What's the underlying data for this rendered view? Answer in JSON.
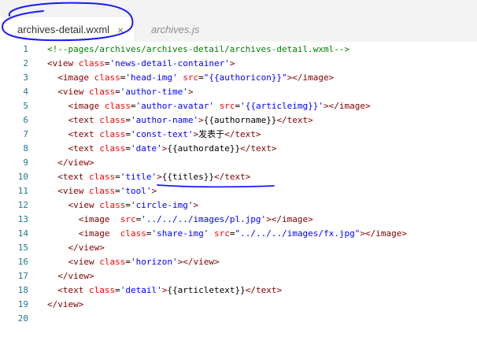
{
  "tabs": [
    {
      "label": "archives-detail.wxml",
      "active": true,
      "close": "×"
    },
    {
      "label": "archives.js",
      "active": false
    }
  ],
  "colors": {
    "comment": "#008000",
    "tag": "#800000",
    "attr": "#ff0000",
    "string": "#0000ff",
    "text": "#000000",
    "line_number": "#237893",
    "annotation": "#1a1aff"
  },
  "lines": [
    {
      "n": "1",
      "tokens": [
        {
          "t": "<!--pages/archives/archives-detail/archives-detail.wxml-->",
          "k": "comment"
        }
      ]
    },
    {
      "n": "2",
      "tokens": [
        {
          "t": "<view ",
          "k": "tag"
        },
        {
          "t": "class",
          "k": "attr"
        },
        {
          "t": "=",
          "k": "text"
        },
        {
          "t": "'news-detail-container'",
          "k": "string"
        },
        {
          "t": ">",
          "k": "tag"
        }
      ]
    },
    {
      "n": "3",
      "tokens": [
        {
          "t": "  ",
          "k": "text"
        },
        {
          "t": "<image ",
          "k": "tag"
        },
        {
          "t": "class",
          "k": "attr"
        },
        {
          "t": "=",
          "k": "text"
        },
        {
          "t": "'head-img'",
          "k": "string"
        },
        {
          "t": " ",
          "k": "text"
        },
        {
          "t": "src",
          "k": "attr"
        },
        {
          "t": "=",
          "k": "text"
        },
        {
          "t": "\"{{authoricon}}\"",
          "k": "string"
        },
        {
          "t": "></image>",
          "k": "tag"
        }
      ]
    },
    {
      "n": "4",
      "tokens": [
        {
          "t": "  ",
          "k": "text"
        },
        {
          "t": "<view ",
          "k": "tag"
        },
        {
          "t": "class",
          "k": "attr"
        },
        {
          "t": "=",
          "k": "text"
        },
        {
          "t": "'author-time'",
          "k": "string"
        },
        {
          "t": ">",
          "k": "tag"
        }
      ]
    },
    {
      "n": "5",
      "tokens": [
        {
          "t": "    ",
          "k": "text"
        },
        {
          "t": "<image ",
          "k": "tag"
        },
        {
          "t": "class",
          "k": "attr"
        },
        {
          "t": "=",
          "k": "text"
        },
        {
          "t": "'author-avatar'",
          "k": "string"
        },
        {
          "t": " ",
          "k": "text"
        },
        {
          "t": "src",
          "k": "attr"
        },
        {
          "t": "=",
          "k": "text"
        },
        {
          "t": "'{{articleimg}}'",
          "k": "string"
        },
        {
          "t": "></image>",
          "k": "tag"
        }
      ]
    },
    {
      "n": "6",
      "tokens": [
        {
          "t": "    ",
          "k": "text"
        },
        {
          "t": "<text ",
          "k": "tag"
        },
        {
          "t": "class",
          "k": "attr"
        },
        {
          "t": "=",
          "k": "text"
        },
        {
          "t": "'author-name'",
          "k": "string"
        },
        {
          "t": ">",
          "k": "tag"
        },
        {
          "t": "{{authorname}}",
          "k": "text"
        },
        {
          "t": "</text>",
          "k": "tag"
        }
      ]
    },
    {
      "n": "7",
      "tokens": [
        {
          "t": "    ",
          "k": "text"
        },
        {
          "t": "<text ",
          "k": "tag"
        },
        {
          "t": "class",
          "k": "attr"
        },
        {
          "t": "=",
          "k": "text"
        },
        {
          "t": "'const-text'",
          "k": "string"
        },
        {
          "t": ">",
          "k": "tag"
        },
        {
          "t": "发表于",
          "k": "text"
        },
        {
          "t": "</text>",
          "k": "tag"
        }
      ]
    },
    {
      "n": "8",
      "tokens": [
        {
          "t": "    ",
          "k": "text"
        },
        {
          "t": "<text ",
          "k": "tag"
        },
        {
          "t": "class",
          "k": "attr"
        },
        {
          "t": "=",
          "k": "text"
        },
        {
          "t": "'date'",
          "k": "string"
        },
        {
          "t": ">",
          "k": "tag"
        },
        {
          "t": "{{authordate}}",
          "k": "text"
        },
        {
          "t": "</text>",
          "k": "tag"
        }
      ]
    },
    {
      "n": "9",
      "tokens": [
        {
          "t": "  ",
          "k": "text"
        },
        {
          "t": "</view>",
          "k": "tag"
        }
      ]
    },
    {
      "n": "10",
      "tokens": [
        {
          "t": "  ",
          "k": "text"
        },
        {
          "t": "<text ",
          "k": "tag"
        },
        {
          "t": "class",
          "k": "attr"
        },
        {
          "t": "=",
          "k": "text"
        },
        {
          "t": "'title'",
          "k": "string"
        },
        {
          "t": ">",
          "k": "tag"
        },
        {
          "t": "{{titles}}",
          "k": "text"
        },
        {
          "t": "</text>",
          "k": "tag"
        }
      ]
    },
    {
      "n": "11",
      "tokens": [
        {
          "t": "  ",
          "k": "text"
        },
        {
          "t": "<view ",
          "k": "tag"
        },
        {
          "t": "class",
          "k": "attr"
        },
        {
          "t": "=",
          "k": "text"
        },
        {
          "t": "'tool'",
          "k": "string"
        },
        {
          "t": ">",
          "k": "tag"
        }
      ]
    },
    {
      "n": "12",
      "tokens": [
        {
          "t": "    ",
          "k": "text"
        },
        {
          "t": "<view ",
          "k": "tag"
        },
        {
          "t": "class",
          "k": "attr"
        },
        {
          "t": "=",
          "k": "text"
        },
        {
          "t": "'circle-img'",
          "k": "string"
        },
        {
          "t": ">",
          "k": "tag"
        }
      ]
    },
    {
      "n": "13",
      "tokens": [
        {
          "t": "      ",
          "k": "text"
        },
        {
          "t": "<image  ",
          "k": "tag"
        },
        {
          "t": "src",
          "k": "attr"
        },
        {
          "t": "=",
          "k": "text"
        },
        {
          "t": "'../../../images/pl.jpg'",
          "k": "string"
        },
        {
          "t": "></image>",
          "k": "tag"
        }
      ]
    },
    {
      "n": "14",
      "tokens": [
        {
          "t": "      ",
          "k": "text"
        },
        {
          "t": "<image  ",
          "k": "tag"
        },
        {
          "t": "class",
          "k": "attr"
        },
        {
          "t": "=",
          "k": "text"
        },
        {
          "t": "'share-img'",
          "k": "string"
        },
        {
          "t": " ",
          "k": "text"
        },
        {
          "t": "src",
          "k": "attr"
        },
        {
          "t": "=",
          "k": "text"
        },
        {
          "t": "\"../../../images/fx.jpg\"",
          "k": "string"
        },
        {
          "t": "></image>",
          "k": "tag"
        }
      ]
    },
    {
      "n": "15",
      "tokens": [
        {
          "t": "    ",
          "k": "text"
        },
        {
          "t": "</view>",
          "k": "tag"
        }
      ]
    },
    {
      "n": "16",
      "tokens": [
        {
          "t": "    ",
          "k": "text"
        },
        {
          "t": "<view ",
          "k": "tag"
        },
        {
          "t": "class",
          "k": "attr"
        },
        {
          "t": "=",
          "k": "text"
        },
        {
          "t": "'horizon'",
          "k": "string"
        },
        {
          "t": "></view>",
          "k": "tag"
        }
      ]
    },
    {
      "n": "17",
      "tokens": [
        {
          "t": "  ",
          "k": "text"
        },
        {
          "t": "</view>",
          "k": "tag"
        }
      ]
    },
    {
      "n": "18",
      "tokens": [
        {
          "t": "  ",
          "k": "text"
        },
        {
          "t": "<text ",
          "k": "tag"
        },
        {
          "t": "class",
          "k": "attr"
        },
        {
          "t": "=",
          "k": "text"
        },
        {
          "t": "'detail'",
          "k": "string"
        },
        {
          "t": ">",
          "k": "tag"
        },
        {
          "t": "{{articletext}}",
          "k": "text"
        },
        {
          "t": "</text>",
          "k": "tag"
        }
      ]
    },
    {
      "n": "19",
      "tokens": [
        {
          "t": "</view>",
          "k": "tag"
        }
      ]
    },
    {
      "n": "20",
      "tokens": []
    }
  ]
}
